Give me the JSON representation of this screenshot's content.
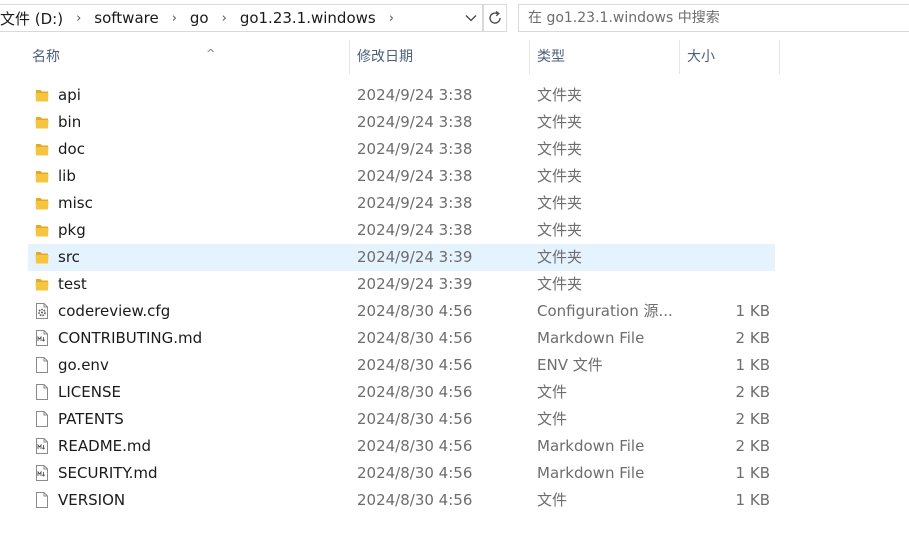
{
  "address": {
    "crumbs": [
      "文件 (D:)",
      "software",
      "go",
      "go1.23.1.windows"
    ],
    "separator": "›"
  },
  "search": {
    "placeholder": "在 go1.23.1.windows 中搜索"
  },
  "columns": {
    "name": "名称",
    "date": "修改日期",
    "type": "类型",
    "size": "大小"
  },
  "colors": {
    "selected_row": "#e5f3ff",
    "folder": "#f5c440",
    "header_text": "#4c607a"
  },
  "files": [
    {
      "name": "api",
      "date": "2024/9/24 3:38",
      "type": "文件夹",
      "size": "",
      "icon": "folder-icon"
    },
    {
      "name": "bin",
      "date": "2024/9/24 3:38",
      "type": "文件夹",
      "size": "",
      "icon": "folder-icon"
    },
    {
      "name": "doc",
      "date": "2024/9/24 3:38",
      "type": "文件夹",
      "size": "",
      "icon": "folder-icon"
    },
    {
      "name": "lib",
      "date": "2024/9/24 3:38",
      "type": "文件夹",
      "size": "",
      "icon": "folder-icon"
    },
    {
      "name": "misc",
      "date": "2024/9/24 3:38",
      "type": "文件夹",
      "size": "",
      "icon": "folder-icon"
    },
    {
      "name": "pkg",
      "date": "2024/9/24 3:38",
      "type": "文件夹",
      "size": "",
      "icon": "folder-icon"
    },
    {
      "name": "src",
      "date": "2024/9/24 3:39",
      "type": "文件夹",
      "size": "",
      "icon": "folder-icon",
      "selected": true
    },
    {
      "name": "test",
      "date": "2024/9/24 3:39",
      "type": "文件夹",
      "size": "",
      "icon": "folder-icon"
    },
    {
      "name": "codereview.cfg",
      "date": "2024/8/30 4:56",
      "type": "Configuration 源...",
      "size": "1 KB",
      "icon": "config-file-icon"
    },
    {
      "name": "CONTRIBUTING.md",
      "date": "2024/8/30 4:56",
      "type": "Markdown File",
      "size": "2 KB",
      "icon": "markdown-file-icon"
    },
    {
      "name": "go.env",
      "date": "2024/8/30 4:56",
      "type": "ENV 文件",
      "size": "1 KB",
      "icon": "file-icon"
    },
    {
      "name": "LICENSE",
      "date": "2024/8/30 4:56",
      "type": "文件",
      "size": "2 KB",
      "icon": "file-icon"
    },
    {
      "name": "PATENTS",
      "date": "2024/8/30 4:56",
      "type": "文件",
      "size": "2 KB",
      "icon": "file-icon"
    },
    {
      "name": "README.md",
      "date": "2024/8/30 4:56",
      "type": "Markdown File",
      "size": "2 KB",
      "icon": "markdown-file-icon"
    },
    {
      "name": "SECURITY.md",
      "date": "2024/8/30 4:56",
      "type": "Markdown File",
      "size": "1 KB",
      "icon": "markdown-file-icon"
    },
    {
      "name": "VERSION",
      "date": "2024/8/30 4:56",
      "type": "文件",
      "size": "1 KB",
      "icon": "file-icon"
    }
  ]
}
